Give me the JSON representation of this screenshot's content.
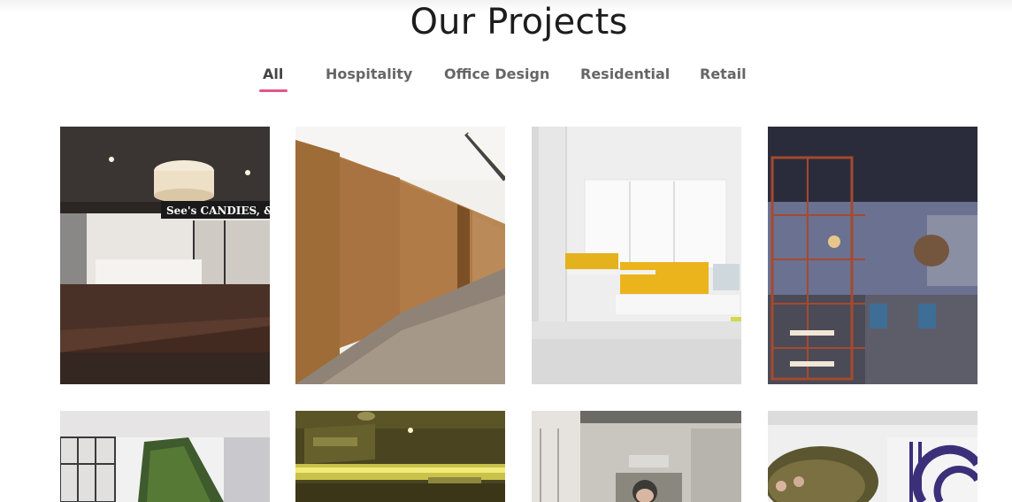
{
  "section": {
    "title": "Our Projects"
  },
  "filters": {
    "items": [
      {
        "label": "All",
        "active": true
      },
      {
        "label": "Hospitality",
        "active": false
      },
      {
        "label": "Office Design",
        "active": false
      },
      {
        "label": "Residential",
        "active": false
      },
      {
        "label": "Retail",
        "active": false
      }
    ],
    "accent_color": "#e1568a"
  },
  "projects": {
    "row1": [
      {
        "image": "cafe-storefront-photo",
        "sign_text": "See's CANDIES, & Cafe"
      },
      {
        "image": "wood-panel-corridor-photo"
      },
      {
        "image": "open-office-desks-photo"
      },
      {
        "image": "glass-office-shelving-photo"
      }
    ],
    "row2": [
      {
        "image": "green-wall-interior-photo"
      },
      {
        "image": "ceiling-lights-interior-photo"
      },
      {
        "image": "office-wall-art-photo"
      },
      {
        "image": "graphic-wall-office-photo"
      }
    ]
  }
}
